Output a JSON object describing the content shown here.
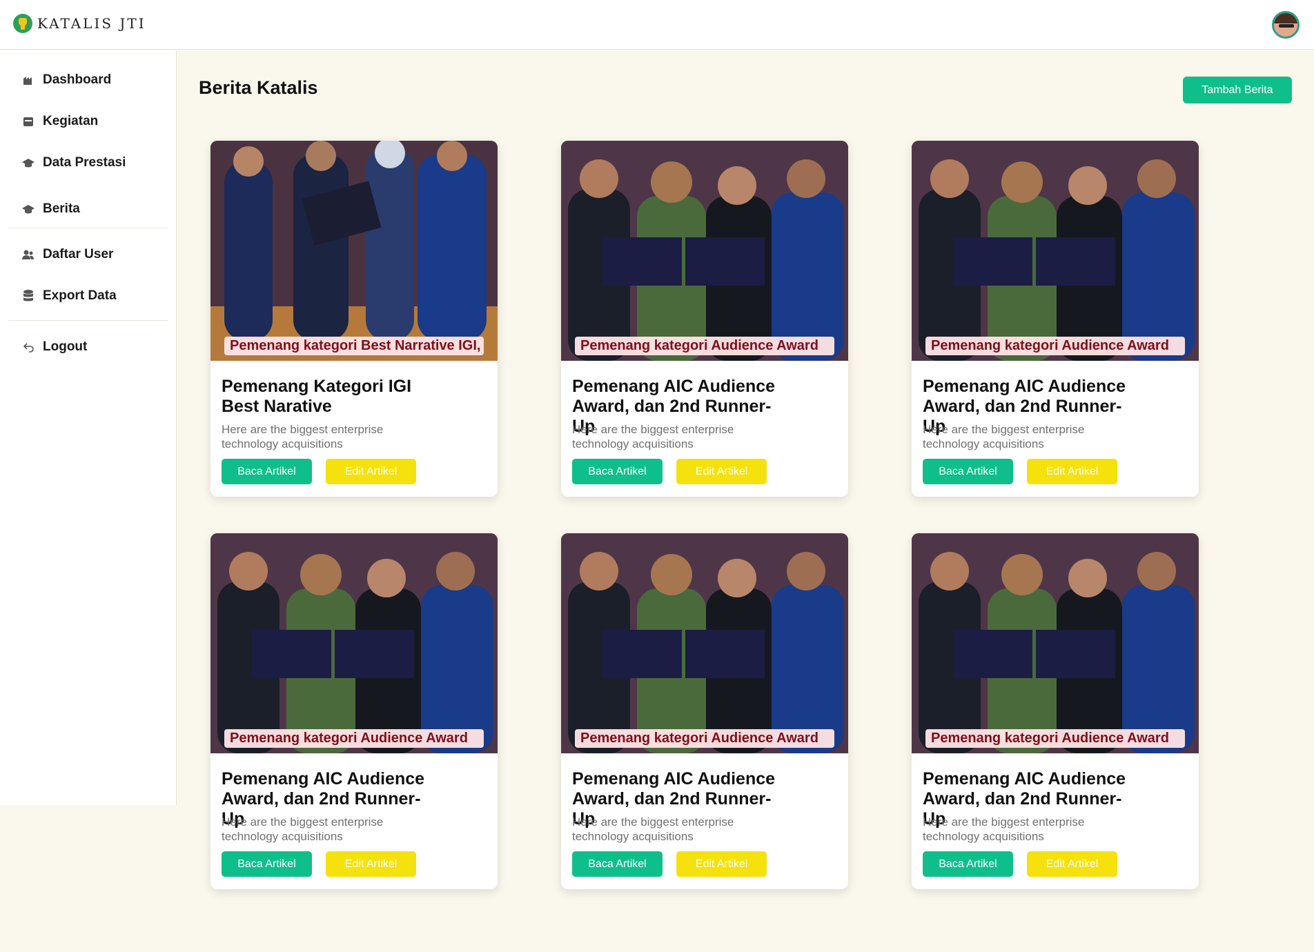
{
  "app": {
    "logo_text": "KATALIS JTI"
  },
  "sidebar": {
    "items": [
      {
        "label": "Dashboard",
        "icon": "dashboard-icon"
      },
      {
        "label": "Kegiatan",
        "icon": "calendar-icon"
      },
      {
        "label": "Data Prestasi",
        "icon": "graduation-cap-icon"
      },
      {
        "label": "Berita",
        "icon": "graduation-cap-icon"
      },
      {
        "label": "Daftar User",
        "icon": "users-icon"
      },
      {
        "label": "Export Data",
        "icon": "database-icon"
      },
      {
        "label": "Logout",
        "icon": "logout-arrow-icon"
      }
    ]
  },
  "main": {
    "title": "Berita Katalis",
    "add_button": "Tambah Berita",
    "cards": [
      {
        "image_caption": "Pemenang kategori Best Narrative IGI,",
        "title": "Pemenang Kategori IGI Best Narative",
        "description": "Here are the biggest enterprise technology acquisitions",
        "read_label": "Baca Artikel",
        "edit_label": "Edit Artikel"
      },
      {
        "image_caption": "Pemenang kategori Audience Award",
        "title": "Pemenang AIC Audience Award, dan 2nd Runner-Up",
        "description": "Here are the biggest enterprise technology acquisitions",
        "read_label": "Baca Artikel",
        "edit_label": "Edit Artikel"
      },
      {
        "image_caption": "Pemenang kategori Audience Award",
        "title": "Pemenang AIC Audience Award, dan 2nd Runner-Up",
        "description": "Here are the biggest enterprise technology acquisitions",
        "read_label": "Baca Artikel",
        "edit_label": "Edit Artikel"
      },
      {
        "image_caption": "Pemenang kategori Audience Award",
        "title": "Pemenang AIC Audience Award, dan 2nd Runner-Up",
        "description": "Here are the biggest enterprise technology acquisitions",
        "read_label": "Baca Artikel",
        "edit_label": "Edit Artikel"
      },
      {
        "image_caption": "Pemenang kategori Audience Award",
        "title": "Pemenang AIC Audience Award, dan 2nd Runner-Up",
        "description": "Here are the biggest enterprise technology acquisitions",
        "read_label": "Baca Artikel",
        "edit_label": "Edit Artikel"
      },
      {
        "image_caption": "Pemenang kategori Audience Award",
        "title": "Pemenang AIC Audience Award, dan 2nd Runner-Up",
        "description": "Here are the biggest enterprise technology acquisitions",
        "read_label": "Baca Artikel",
        "edit_label": "Edit Artikel"
      }
    ]
  },
  "colors": {
    "primary": "#0fbf8b",
    "edit": "#f5e10c",
    "background": "#faf7ec"
  }
}
